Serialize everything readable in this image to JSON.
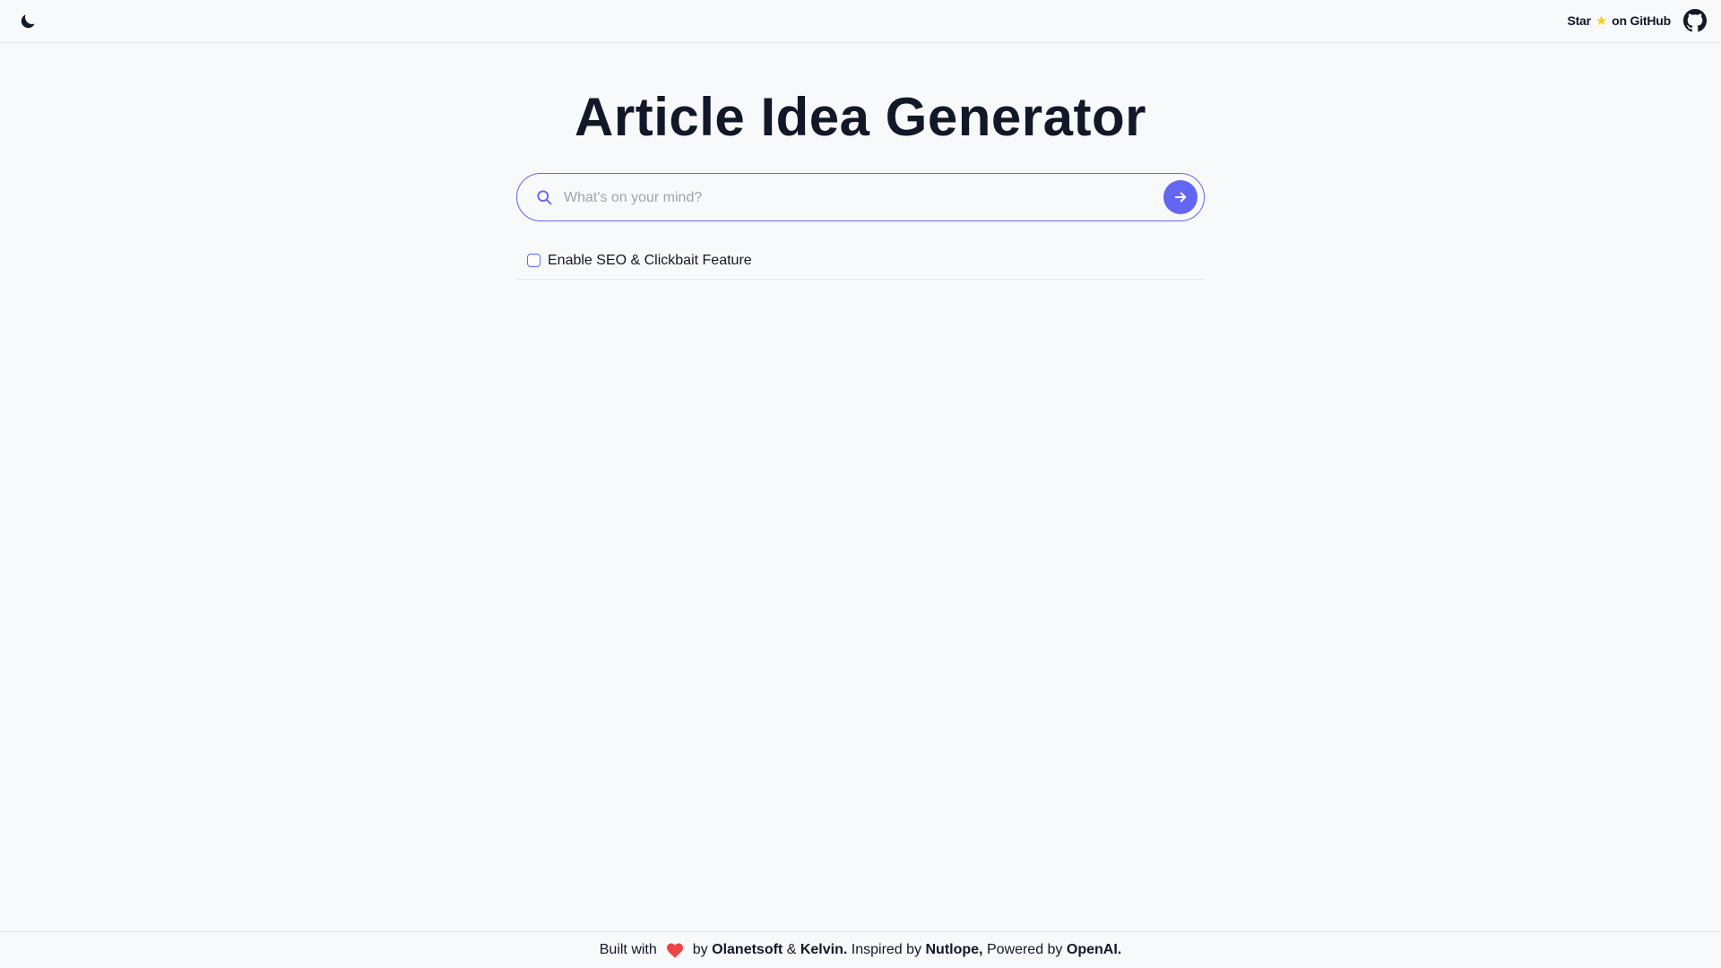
{
  "header": {
    "theme_toggle_icon": "moon-icon",
    "star_label": "Star",
    "star_icon": "star-icon",
    "github_label": "on GitHub",
    "github_icon": "github-icon"
  },
  "main": {
    "title": "Article Idea Generator",
    "search": {
      "placeholder": "What's on your mind?",
      "value": "",
      "icon": "search-icon",
      "submit_icon": "arrow-right-icon"
    },
    "seo_option": {
      "label": "Enable SEO & Clickbait Feature",
      "checked": false
    }
  },
  "footer": {
    "built_with": "Built with",
    "heart_icon": "heart-icon",
    "by": "by",
    "author1": "Olanetsoft",
    "amp": "&",
    "author2": "Kelvin.",
    "inspired_by": "Inspired by",
    "inspiration": "Nutlope,",
    "powered_by": "Powered by",
    "provider": "OpenAI."
  },
  "colors": {
    "accent": "#6366f1",
    "star": "#facc15",
    "heart": "#ef4444",
    "text": "#111827",
    "background": "#f8f9fb"
  }
}
